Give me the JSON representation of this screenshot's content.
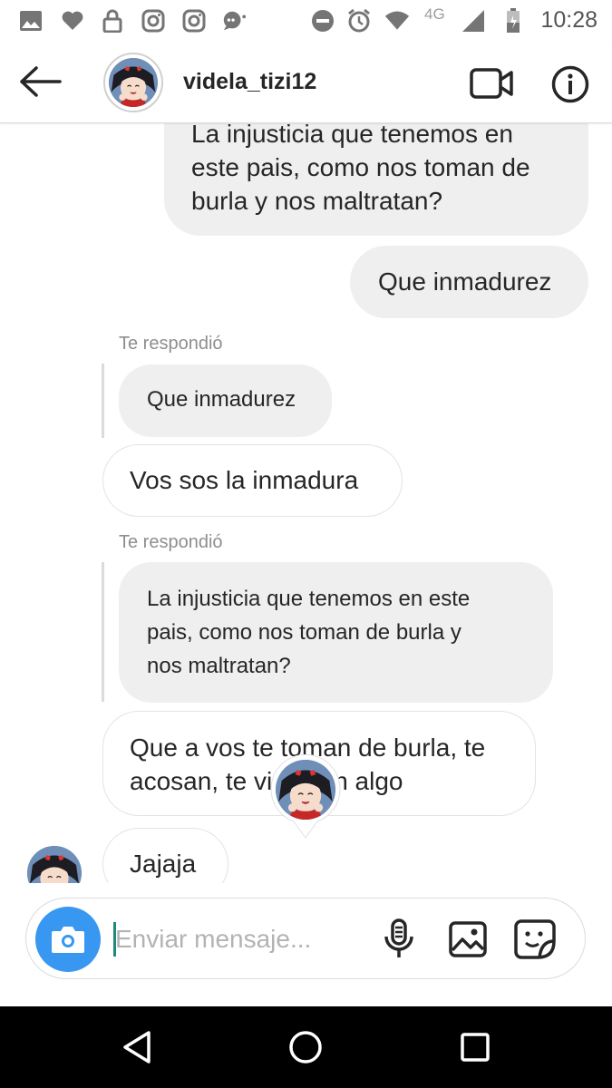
{
  "status_bar": {
    "time": "10:28",
    "network": "4G",
    "icons": [
      "gallery-icon",
      "heart-icon",
      "lock-icon",
      "instagram-icon",
      "instagram-icon",
      "chat-bubble-icon",
      "do-not-disturb-icon",
      "alarm-icon",
      "wifi-icon",
      "cell-signal-icon",
      "battery-icon"
    ]
  },
  "header": {
    "username": "videla_tizi12",
    "back_icon": "arrow-left-icon",
    "video_icon": "video-camera-icon",
    "info_icon": "info-icon"
  },
  "messages": {
    "m1": "La injusticia que tenemos en este pais, como nos toman de burla y nos maltratan?",
    "m1_lines": [
      "La injusticia que tenemos en",
      "este pais, como nos toman de",
      "burla y nos maltratan?"
    ],
    "m2": "Que inmadurez",
    "reply1_label": "Te respondió",
    "reply1_quote": "Que inmadurez",
    "m3": "Vos sos la inmadura",
    "reply2_label": "Te respondió",
    "reply2_quote_lines": [
      "La injusticia que tenemos en este",
      "pais, como nos toman de burla y",
      "nos maltratan?"
    ],
    "m4_lines": [
      "Que a vos te toman de burla, te",
      "acosan, te vi",
      "n algo"
    ],
    "m5": "Jajaja"
  },
  "composer": {
    "placeholder": "Enviar mensaje...",
    "camera_icon": "camera-icon",
    "mic_icon": "microphone-icon",
    "gallery_icon": "image-icon",
    "sticker_icon": "sticker-icon"
  },
  "nav": {
    "back_icon": "nav-back-triangle-icon",
    "home_icon": "nav-home-circle-icon",
    "recents_icon": "nav-recents-square-icon"
  },
  "colors": {
    "accent": "#3897f0",
    "bubble_mine": "#efefef",
    "muted_text": "#8e8e8e",
    "navbar": "#000000"
  }
}
